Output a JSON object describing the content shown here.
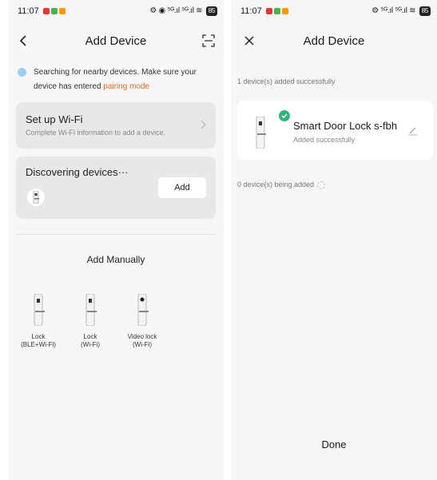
{
  "left": {
    "status": {
      "time": "11:07",
      "signal": "⚙ ◉ ⁵ᴳ.ıl ⁵ᴳ.ıl ≋",
      "battery": "85"
    },
    "header": {
      "title": "Add Device"
    },
    "search": {
      "text": "Searching for nearby devices. Make sure your device has entered ",
      "link": "pairing mode"
    },
    "wifi_card": {
      "title": "Set up Wi-Fi",
      "subtitle": "Complete Wi-Fi information to add a device."
    },
    "discover_card": {
      "title": "Discovering devices···",
      "add_label": "Add"
    },
    "manual": {
      "title": "Add Manually",
      "items": [
        {
          "line1": "Lock",
          "line2": "(BLE+Wi-Fi)",
          "icon": "smart-lock-icon"
        },
        {
          "line1": "Lock",
          "line2": "(Wi-Fi)",
          "icon": "smart-lock-icon"
        },
        {
          "line1": "Video lock",
          "line2": "(Wi-Fi)",
          "icon": "video-lock-icon"
        }
      ]
    }
  },
  "right": {
    "status": {
      "time": "11:07",
      "signal": "⚙ ⁵ᴳ.ıl ⁵ᴳ.ıl ≋",
      "battery": "85"
    },
    "header": {
      "title": "Add Device"
    },
    "added_label": "1 device(s) added successfully",
    "device": {
      "name": "Smart Door Lock s-fbh",
      "status": "Added successfully"
    },
    "adding_label": "0 device(s) being added",
    "done_label": "Done"
  },
  "colors": {
    "accent": "#f26a21",
    "success": "#2eb67d",
    "card": "#e8e8e8"
  }
}
